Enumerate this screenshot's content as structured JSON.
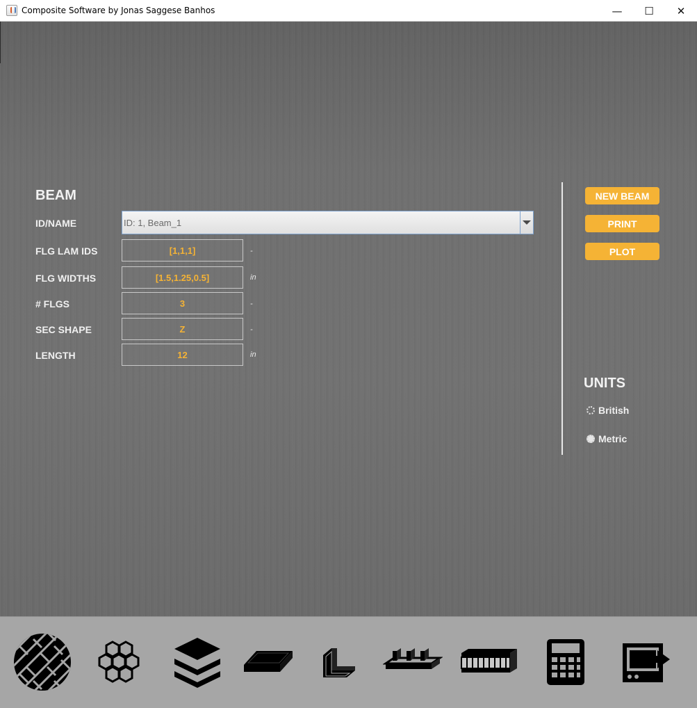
{
  "window": {
    "title": "Composite Software by Jonas Saggese Banhos"
  },
  "window_controls": {
    "minimize": "—",
    "maximize": "☐",
    "close": "✕"
  },
  "beam": {
    "title": "BEAM",
    "id_name_label": "ID/NAME",
    "id_name_value": "ID: 1, Beam_1",
    "fields": [
      {
        "label": "FLG LAM IDS",
        "value": "[1,1,1]",
        "unit": "-"
      },
      {
        "label": "FLG WIDTHS",
        "value": "[1.5,1.25,0.5]",
        "unit": "in"
      },
      {
        "label": "# FLGS",
        "value": "3",
        "unit": "-"
      },
      {
        "label": "SEC SHAPE",
        "value": "Z",
        "unit": "-"
      },
      {
        "label": "LENGTH",
        "value": "12",
        "unit": "in"
      }
    ]
  },
  "actions": {
    "new_beam": "NEW BEAM",
    "print": "PRINT",
    "plot": "PLOT"
  },
  "units": {
    "title": "UNITS",
    "options": [
      "British",
      "Metric"
    ],
    "selected": "Metric"
  },
  "toolbar": {
    "icons": [
      "woven-fabric-icon",
      "honeycomb-icon",
      "layers-icon",
      "plate-icon",
      "angle-section-icon",
      "stiffened-panel-icon",
      "sandwich-panel-icon",
      "calculator-icon",
      "exit-icon"
    ]
  },
  "colors": {
    "accent": "#f5b335",
    "background": "#6e6e6e",
    "toolbar": "#a6a6a6",
    "text": "#f0f0f0"
  }
}
